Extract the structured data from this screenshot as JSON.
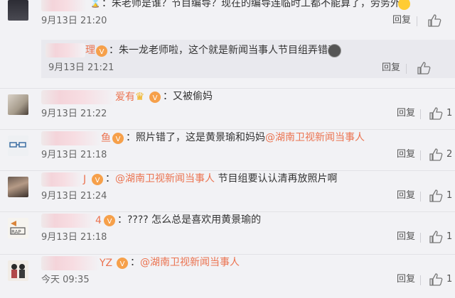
{
  "comments": [
    {
      "name_visible": "...",
      "text": "：朱老师是谁？节目编导？现在的编导连临时工都不能算了，劳务外包",
      "time": "9月13日 21:20",
      "reply_label": "回复",
      "likes": ""
    },
    {
      "name_visible": "理",
      "text": "：朱一龙老师啦，这个就是新闻当事人节目组弄错了",
      "time": "9月13日 21:21",
      "reply_label": "回复",
      "likes": ""
    },
    {
      "name_visible": "爱有",
      "text": "：又被偷妈",
      "time": "9月13日 21:22",
      "reply_label": "回复",
      "likes": "1"
    },
    {
      "name_visible": "鱼",
      "text": "：照片错了，这是黄景瑜和妈妈",
      "mention": "@湖南卫视新闻当事人",
      "time": "9月13日 21:18",
      "reply_label": "回复",
      "likes": "2"
    },
    {
      "name_visible": "J",
      "text_prefix": "：",
      "mention": "@湖南卫视新闻当事人",
      "text": " 节目组要认认清再放照片啊",
      "time": "9月13日 21:24",
      "reply_label": "回复",
      "likes": "1"
    },
    {
      "name_visible": "4",
      "text": "：???? 怎么总是喜欢用黄景瑜的",
      "time": "9月13日 21:18",
      "reply_label": "回复",
      "likes": "1"
    },
    {
      "name_visible": "YZ",
      "text_prefix": "：",
      "mention": "@湖南卫视新闻当事人",
      "time": "今天 09:35",
      "reply_label": "回复",
      "likes": "1"
    }
  ],
  "colors": {
    "background": "#f2f2f5",
    "reply_background": "#e9e9ee",
    "mention": "#eb7350",
    "time": "#666666"
  }
}
